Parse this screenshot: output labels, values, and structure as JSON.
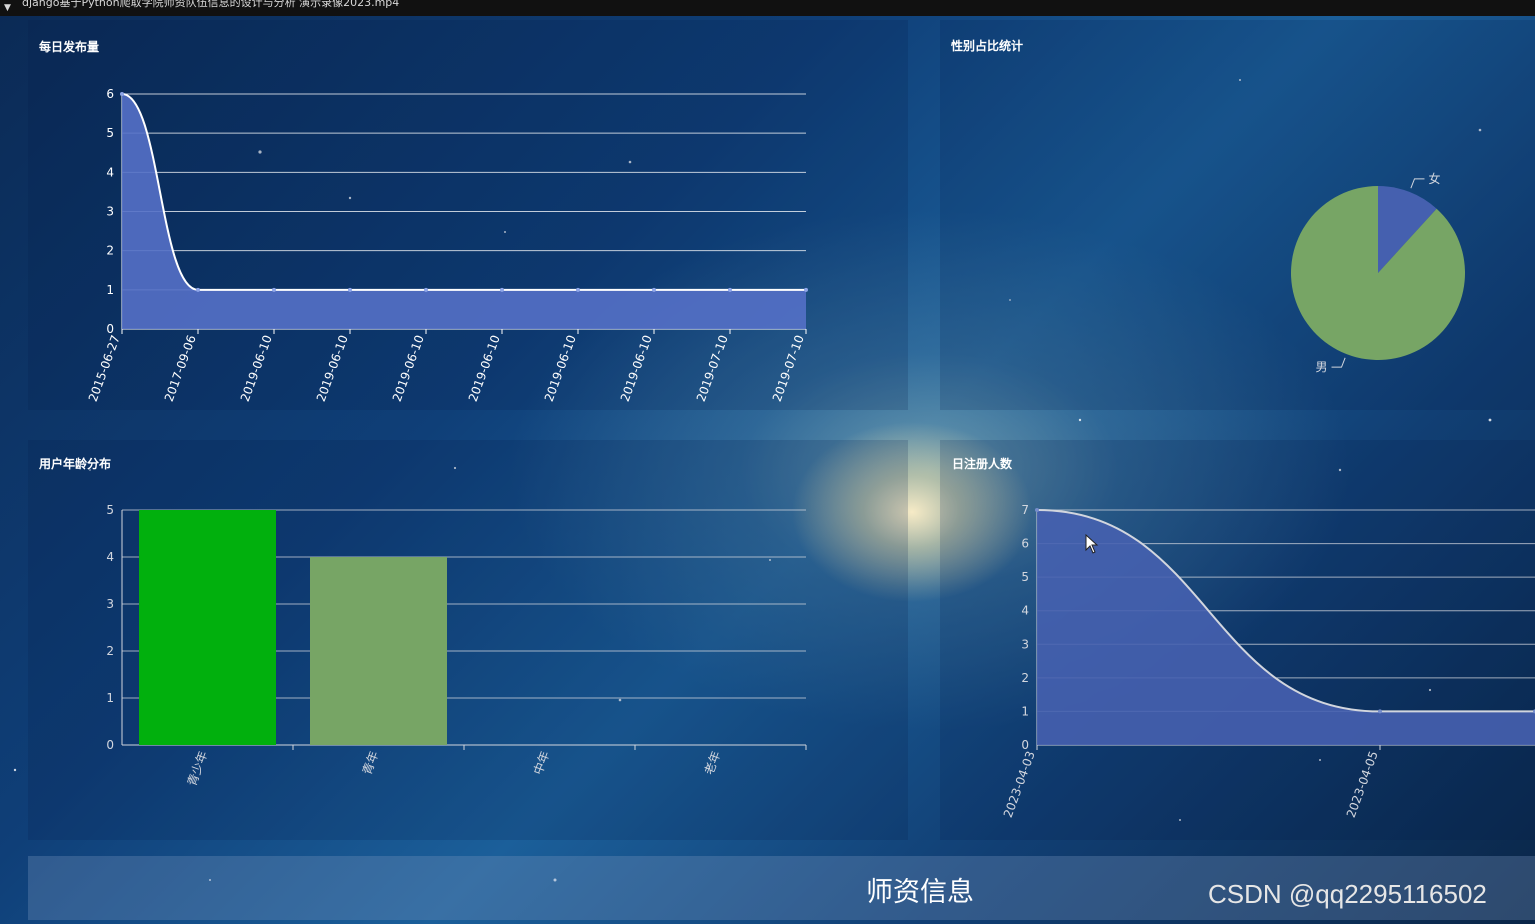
{
  "window": {
    "title": "django基于Python爬取学院师资队伍信息的设计与分析 演示录像2023.mp4"
  },
  "panels": {
    "daily_posts": {
      "title": "每日发布量"
    },
    "gender": {
      "title": "性别占比统计"
    },
    "age": {
      "title": "用户年龄分布"
    },
    "registrations": {
      "title": "日注册人数"
    }
  },
  "footer": {
    "title": "师资信息",
    "watermark": "CSDN @qq2295116502"
  },
  "colors": {
    "area_fill": "#5470c6",
    "line": "#ffffff",
    "bar_green": "#00d100",
    "bar_light_green": "#91c46c",
    "pie_female": "#5470c6",
    "pie_male": "#91c46c"
  },
  "chart_data": [
    {
      "id": "daily_posts",
      "type": "area",
      "title": "每日发布量",
      "categories": [
        "2015-06-27",
        "2017-09-06",
        "2019-06-10",
        "2019-06-10",
        "2019-06-10",
        "2019-06-10",
        "2019-06-10",
        "2019-06-10",
        "2019-07-10",
        "2019-07-10"
      ],
      "values": [
        6,
        1,
        1,
        1,
        1,
        1,
        1,
        1,
        1,
        1
      ],
      "yticks": [
        0,
        1,
        2,
        3,
        4,
        5,
        6
      ],
      "ylim": [
        0,
        6
      ],
      "grid": true
    },
    {
      "id": "gender",
      "type": "pie",
      "title": "性别占比统计",
      "slices": [
        {
          "label": "女",
          "value": 1
        },
        {
          "label": "男",
          "value": 7.5
        }
      ]
    },
    {
      "id": "age",
      "type": "bar",
      "title": "用户年龄分布",
      "categories": [
        "青少年",
        "青年",
        "中年",
        "老年"
      ],
      "values": [
        5,
        4,
        0,
        0
      ],
      "yticks": [
        0,
        1,
        2,
        3,
        4,
        5
      ],
      "ylim": [
        0,
        5
      ],
      "grid": true
    },
    {
      "id": "registrations",
      "type": "area",
      "title": "日注册人数",
      "categories": [
        "2023-04-03",
        "2023-04-05",
        ""
      ],
      "values": [
        7,
        1,
        1
      ],
      "yticks": [
        0,
        1,
        2,
        3,
        4,
        5,
        6,
        7
      ],
      "ylim": [
        0,
        7
      ],
      "grid": true
    }
  ]
}
